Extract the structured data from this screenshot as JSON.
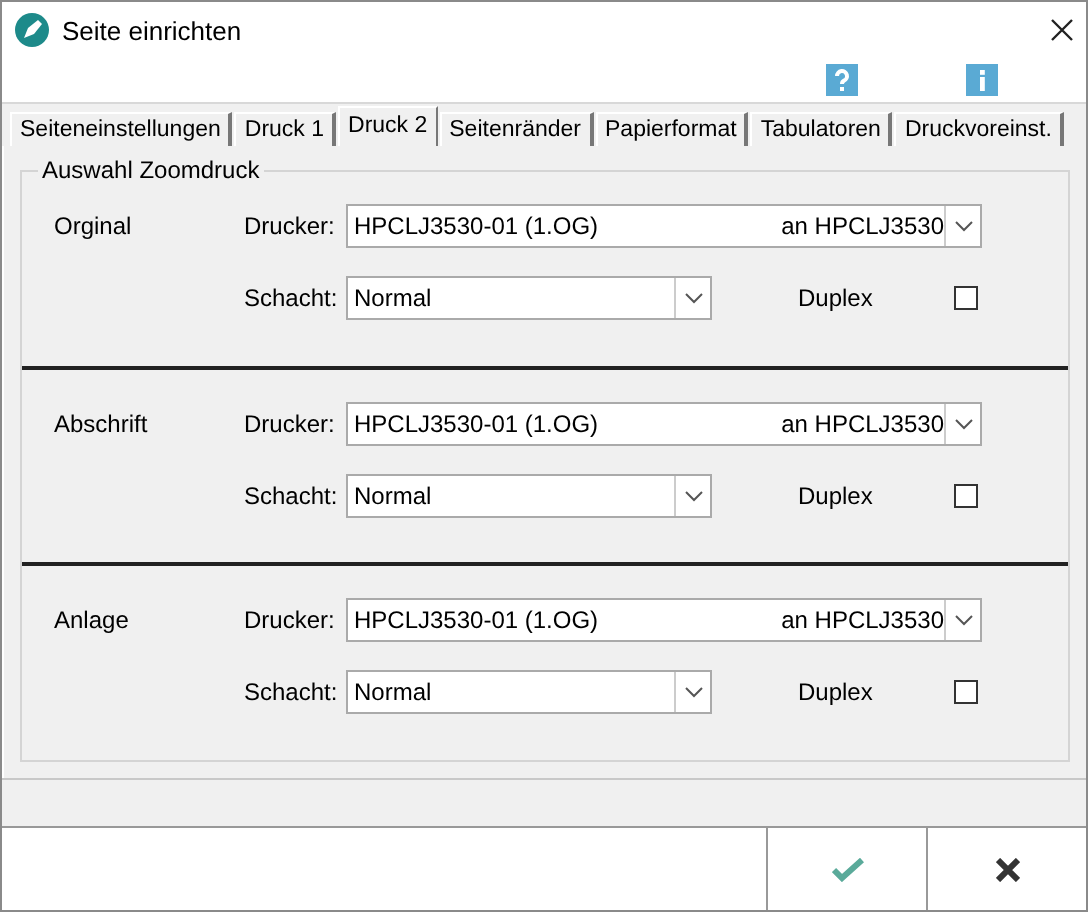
{
  "window": {
    "title": "Seite einrichten"
  },
  "tabs": [
    {
      "label": "Seiteneinstellungen",
      "selected": false
    },
    {
      "label": "Druck 1",
      "selected": false
    },
    {
      "label": "Druck 2",
      "selected": true
    },
    {
      "label": "Seitenränder",
      "selected": false
    },
    {
      "label": "Papierformat",
      "selected": false
    },
    {
      "label": "Tabulatoren",
      "selected": false
    },
    {
      "label": "Druckvoreinst.",
      "selected": false
    }
  ],
  "group": {
    "title": "Auswahl Zoomdruck",
    "sections": [
      {
        "name": "Orginal",
        "printer_label": "Drucker:",
        "printer": "HPCLJ3530-01 (1.OG)",
        "printer_port": "an HPCLJ3530",
        "tray_label": "Schacht:",
        "tray": "Normal",
        "duplex_label": "Duplex",
        "duplex_checked": false
      },
      {
        "name": "Abschrift",
        "printer_label": "Drucker:",
        "printer": "HPCLJ3530-01 (1.OG)",
        "printer_port": "an HPCLJ3530",
        "tray_label": "Schacht:",
        "tray": "Normal",
        "duplex_label": "Duplex",
        "duplex_checked": false
      },
      {
        "name": "Anlage",
        "printer_label": "Drucker:",
        "printer": "HPCLJ3530-01 (1.OG)",
        "printer_port": "an HPCLJ3530",
        "tray_label": "Schacht:",
        "tray": "Normal",
        "duplex_label": "Duplex",
        "duplex_checked": false
      }
    ]
  }
}
